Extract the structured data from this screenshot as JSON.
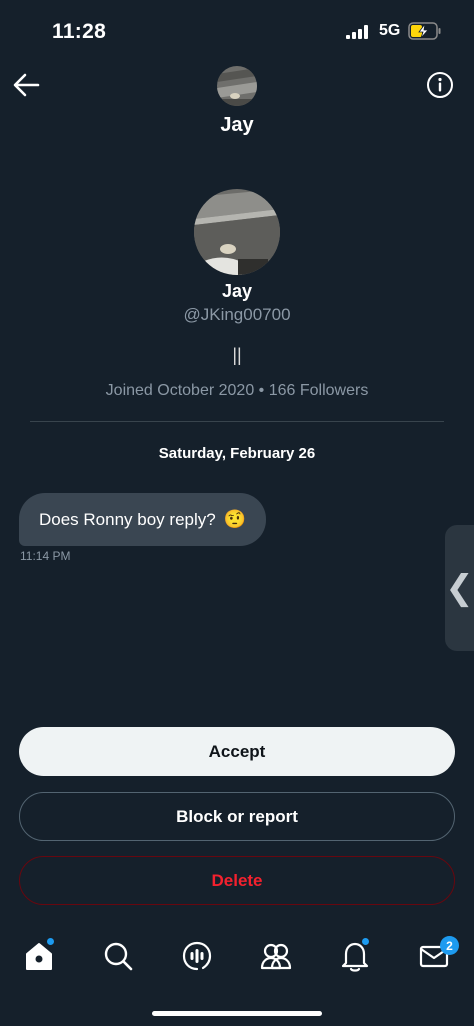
{
  "status_bar": {
    "time": "11:28",
    "network": "5G"
  },
  "header": {
    "name": "Jay"
  },
  "profile": {
    "name": "Jay",
    "handle": "@JKing00700",
    "bio": "||",
    "meta": "Joined October 2020 • 166 Followers"
  },
  "conversation": {
    "date": "Saturday, February 26",
    "messages": [
      {
        "text": "Does Ronny boy reply?",
        "emoji": "🤨",
        "time": "11:14 PM"
      }
    ]
  },
  "side_handle": {
    "glyph": "❮"
  },
  "actions": {
    "accept": "Accept",
    "block": "Block or report",
    "delete": "Delete"
  },
  "nav": {
    "items": [
      "home-icon",
      "search-icon",
      "spaces-icon",
      "communities-icon",
      "notifications-icon",
      "messages-icon"
    ],
    "messages_badge": "2"
  },
  "colors": {
    "background": "#15202b",
    "accent": "#1d9bf0",
    "danger": "#f4212e",
    "bubble": "#3a4652"
  }
}
